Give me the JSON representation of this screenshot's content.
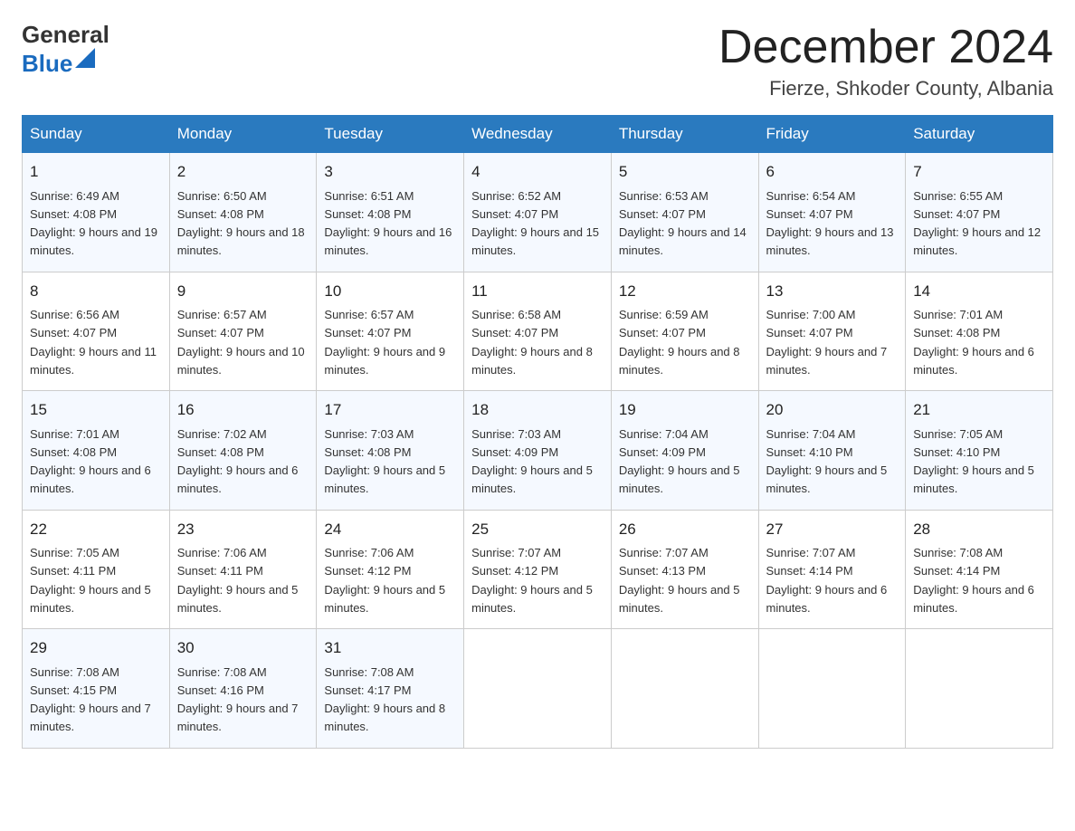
{
  "header": {
    "logo_general": "General",
    "logo_blue": "Blue",
    "month_title": "December 2024",
    "location": "Fierze, Shkoder County, Albania"
  },
  "weekdays": [
    "Sunday",
    "Monday",
    "Tuesday",
    "Wednesday",
    "Thursday",
    "Friday",
    "Saturday"
  ],
  "weeks": [
    [
      {
        "day": "1",
        "sunrise": "6:49 AM",
        "sunset": "4:08 PM",
        "daylight": "9 hours and 19 minutes."
      },
      {
        "day": "2",
        "sunrise": "6:50 AM",
        "sunset": "4:08 PM",
        "daylight": "9 hours and 18 minutes."
      },
      {
        "day": "3",
        "sunrise": "6:51 AM",
        "sunset": "4:08 PM",
        "daylight": "9 hours and 16 minutes."
      },
      {
        "day": "4",
        "sunrise": "6:52 AM",
        "sunset": "4:07 PM",
        "daylight": "9 hours and 15 minutes."
      },
      {
        "day": "5",
        "sunrise": "6:53 AM",
        "sunset": "4:07 PM",
        "daylight": "9 hours and 14 minutes."
      },
      {
        "day": "6",
        "sunrise": "6:54 AM",
        "sunset": "4:07 PM",
        "daylight": "9 hours and 13 minutes."
      },
      {
        "day": "7",
        "sunrise": "6:55 AM",
        "sunset": "4:07 PM",
        "daylight": "9 hours and 12 minutes."
      }
    ],
    [
      {
        "day": "8",
        "sunrise": "6:56 AM",
        "sunset": "4:07 PM",
        "daylight": "9 hours and 11 minutes."
      },
      {
        "day": "9",
        "sunrise": "6:57 AM",
        "sunset": "4:07 PM",
        "daylight": "9 hours and 10 minutes."
      },
      {
        "day": "10",
        "sunrise": "6:57 AM",
        "sunset": "4:07 PM",
        "daylight": "9 hours and 9 minutes."
      },
      {
        "day": "11",
        "sunrise": "6:58 AM",
        "sunset": "4:07 PM",
        "daylight": "9 hours and 8 minutes."
      },
      {
        "day": "12",
        "sunrise": "6:59 AM",
        "sunset": "4:07 PM",
        "daylight": "9 hours and 8 minutes."
      },
      {
        "day": "13",
        "sunrise": "7:00 AM",
        "sunset": "4:07 PM",
        "daylight": "9 hours and 7 minutes."
      },
      {
        "day": "14",
        "sunrise": "7:01 AM",
        "sunset": "4:08 PM",
        "daylight": "9 hours and 6 minutes."
      }
    ],
    [
      {
        "day": "15",
        "sunrise": "7:01 AM",
        "sunset": "4:08 PM",
        "daylight": "9 hours and 6 minutes."
      },
      {
        "day": "16",
        "sunrise": "7:02 AM",
        "sunset": "4:08 PM",
        "daylight": "9 hours and 6 minutes."
      },
      {
        "day": "17",
        "sunrise": "7:03 AM",
        "sunset": "4:08 PM",
        "daylight": "9 hours and 5 minutes."
      },
      {
        "day": "18",
        "sunrise": "7:03 AM",
        "sunset": "4:09 PM",
        "daylight": "9 hours and 5 minutes."
      },
      {
        "day": "19",
        "sunrise": "7:04 AM",
        "sunset": "4:09 PM",
        "daylight": "9 hours and 5 minutes."
      },
      {
        "day": "20",
        "sunrise": "7:04 AM",
        "sunset": "4:10 PM",
        "daylight": "9 hours and 5 minutes."
      },
      {
        "day": "21",
        "sunrise": "7:05 AM",
        "sunset": "4:10 PM",
        "daylight": "9 hours and 5 minutes."
      }
    ],
    [
      {
        "day": "22",
        "sunrise": "7:05 AM",
        "sunset": "4:11 PM",
        "daylight": "9 hours and 5 minutes."
      },
      {
        "day": "23",
        "sunrise": "7:06 AM",
        "sunset": "4:11 PM",
        "daylight": "9 hours and 5 minutes."
      },
      {
        "day": "24",
        "sunrise": "7:06 AM",
        "sunset": "4:12 PM",
        "daylight": "9 hours and 5 minutes."
      },
      {
        "day": "25",
        "sunrise": "7:07 AM",
        "sunset": "4:12 PM",
        "daylight": "9 hours and 5 minutes."
      },
      {
        "day": "26",
        "sunrise": "7:07 AM",
        "sunset": "4:13 PM",
        "daylight": "9 hours and 5 minutes."
      },
      {
        "day": "27",
        "sunrise": "7:07 AM",
        "sunset": "4:14 PM",
        "daylight": "9 hours and 6 minutes."
      },
      {
        "day": "28",
        "sunrise": "7:08 AM",
        "sunset": "4:14 PM",
        "daylight": "9 hours and 6 minutes."
      }
    ],
    [
      {
        "day": "29",
        "sunrise": "7:08 AM",
        "sunset": "4:15 PM",
        "daylight": "9 hours and 7 minutes."
      },
      {
        "day": "30",
        "sunrise": "7:08 AM",
        "sunset": "4:16 PM",
        "daylight": "9 hours and 7 minutes."
      },
      {
        "day": "31",
        "sunrise": "7:08 AM",
        "sunset": "4:17 PM",
        "daylight": "9 hours and 8 minutes."
      },
      null,
      null,
      null,
      null
    ]
  ],
  "labels": {
    "sunrise_prefix": "Sunrise: ",
    "sunset_prefix": "Sunset: ",
    "daylight_prefix": "Daylight: "
  }
}
